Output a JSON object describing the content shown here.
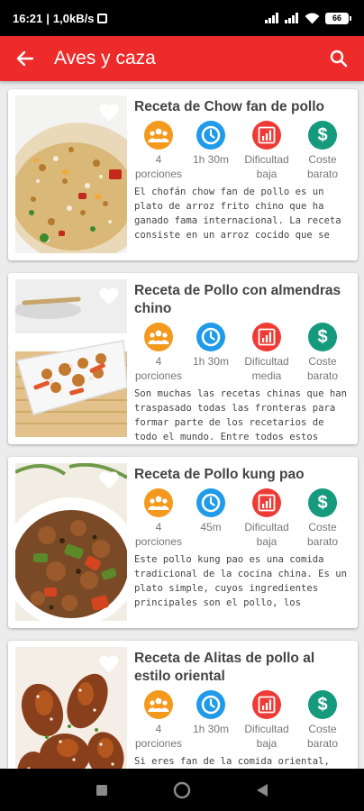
{
  "status_bar": {
    "time": "16:21",
    "speed": "1,0kB/s",
    "battery": "66"
  },
  "app_bar": {
    "title": "Aves y caza"
  },
  "colors": {
    "brand": "#ee2b2b",
    "portions": "#f39a1e",
    "time": "#1f9be9",
    "difficulty": "#ee3b36",
    "cost": "#169a7e"
  },
  "icons": {
    "back": "arrow-back-icon",
    "search": "search-icon",
    "favorite": "heart-icon",
    "portions": "people-icon",
    "time": "clock-icon",
    "difficulty": "bar-chart-icon",
    "cost": "dollar-icon"
  },
  "recipes": [
    {
      "title": "Receta de Chow fan de pollo",
      "portions": "4 porciones",
      "time": "1h 30m",
      "difficulty": "Dificultad baja",
      "cost": "Coste barato",
      "description": "El chofán chow fan de pollo es un plato de arroz frito chino que ha ganado fama internacional. La receta consiste en un arroz cocido que se saltea a fuego alto..."
    },
    {
      "title": "Receta de Pollo con almendras chino",
      "portions": "4 porciones",
      "time": "1h 30m",
      "difficulty": "Dificultad media",
      "cost": "Coste barato",
      "description": "Son muchas las recetas chinas que han traspasado todas las fronteras para formar parte de los recetarios de todo el mundo. Entre todos estos platos, ha..."
    },
    {
      "title": "Receta de Pollo kung pao",
      "portions": "4 porciones",
      "time": "45m",
      "difficulty": "Dificultad baja",
      "cost": "Coste barato",
      "description": "Este pollo kung pao es una comida tradicional de la cocina china. Es un plato simple, cuyos ingredientes principales son el pollo, los pimientos..."
    },
    {
      "title": "Receta de Alitas de pollo al estilo oriental",
      "portions": "4 porciones",
      "time": "1h 30m",
      "difficulty": "Dificultad baja",
      "cost": "Coste barato",
      "description": "Si eres fan de la comida oriental, seguro"
    }
  ]
}
